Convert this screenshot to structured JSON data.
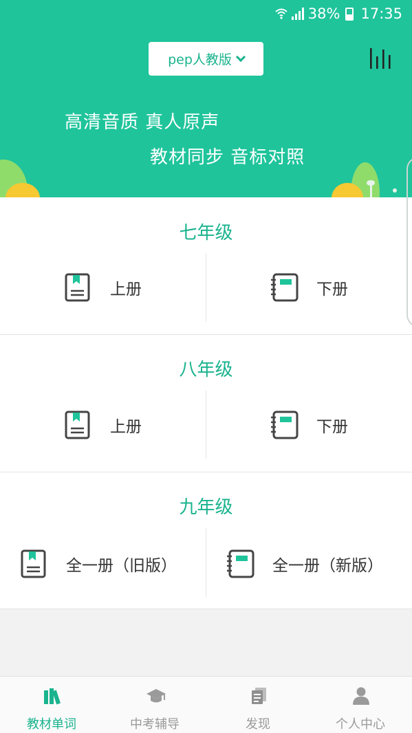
{
  "status_bar": {
    "battery": "38%",
    "time": "17:35"
  },
  "header": {
    "edition_label": "pep人教版",
    "slogan_line1": "高清音质  真人原声",
    "slogan_line2": "教材同步  音标对照"
  },
  "grades": [
    {
      "title": "七年级",
      "left_label": "上册",
      "right_label": "下册"
    },
    {
      "title": "八年级",
      "left_label": "上册",
      "right_label": "下册"
    },
    {
      "title": "九年级",
      "left_label": "全一册（旧版）",
      "right_label": "全一册（新版）"
    }
  ],
  "nav": [
    {
      "label": "教材单词",
      "icon": "books-icon",
      "active": true
    },
    {
      "label": "中考辅导",
      "icon": "graduation-cap-icon",
      "active": false
    },
    {
      "label": "发现",
      "icon": "document-icon",
      "active": false
    },
    {
      "label": "个人中心",
      "icon": "person-icon",
      "active": false
    }
  ],
  "colors": {
    "primary": "#1fc49b",
    "accent_text": "#1ab38e",
    "hill_yellow": "#f6c832",
    "hill_green": "#7fd85a"
  }
}
